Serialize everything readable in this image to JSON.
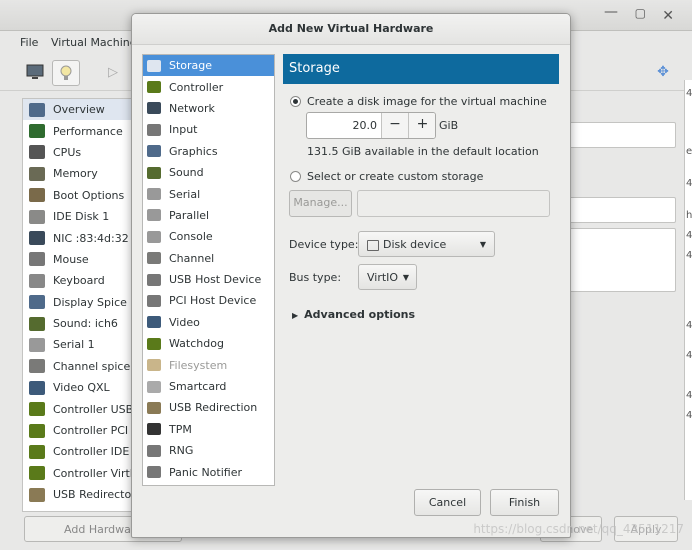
{
  "background_window": {
    "menu": [
      "File",
      "Virtual Machine"
    ],
    "hardware_list": [
      {
        "label": "Overview",
        "icon": "monitor-icon",
        "selected": true
      },
      {
        "label": "Performance",
        "icon": "performance-graph-icon"
      },
      {
        "label": "CPUs",
        "icon": "cpu-icon"
      },
      {
        "label": "Memory",
        "icon": "memory-icon"
      },
      {
        "label": "Boot Options",
        "icon": "boot-options-icon"
      },
      {
        "label": "IDE Disk 1",
        "icon": "disk-icon"
      },
      {
        "label": "NIC :83:4d:32",
        "icon": "nic-icon"
      },
      {
        "label": "Mouse",
        "icon": "mouse-icon"
      },
      {
        "label": "Keyboard",
        "icon": "keyboard-icon"
      },
      {
        "label": "Display Spice",
        "icon": "display-icon"
      },
      {
        "label": "Sound: ich6",
        "icon": "sound-icon"
      },
      {
        "label": "Serial 1",
        "icon": "serial-icon"
      },
      {
        "label": "Channel spice",
        "icon": "channel-icon"
      },
      {
        "label": "Video QXL",
        "icon": "video-icon"
      },
      {
        "label": "Controller USB",
        "icon": "controller-icon"
      },
      {
        "label": "Controller PCI",
        "icon": "controller-icon"
      },
      {
        "label": "Controller IDE",
        "icon": "controller-icon"
      },
      {
        "label": "Controller VirtIO",
        "icon": "controller-icon"
      },
      {
        "label": "USB Redirector",
        "icon": "usb-redirector-icon"
      }
    ],
    "add_hardware_label": "Add Hardware",
    "remove_label": "Remove",
    "apply_label": "Apply"
  },
  "dialog": {
    "title": "Add New Virtual Hardware",
    "device_list": [
      {
        "label": "Storage",
        "icon": "storage-icon",
        "selected": true
      },
      {
        "label": "Controller",
        "icon": "controller-icon"
      },
      {
        "label": "Network",
        "icon": "network-icon"
      },
      {
        "label": "Input",
        "icon": "input-mouse-icon"
      },
      {
        "label": "Graphics",
        "icon": "graphics-monitor-icon"
      },
      {
        "label": "Sound",
        "icon": "sound-card-icon"
      },
      {
        "label": "Serial",
        "icon": "serial-icon"
      },
      {
        "label": "Parallel",
        "icon": "parallel-icon"
      },
      {
        "label": "Console",
        "icon": "console-icon"
      },
      {
        "label": "Channel",
        "icon": "channel-icon"
      },
      {
        "label": "USB Host Device",
        "icon": "usb-host-icon"
      },
      {
        "label": "PCI Host Device",
        "icon": "pci-host-icon"
      },
      {
        "label": "Video",
        "icon": "video-icon"
      },
      {
        "label": "Watchdog",
        "icon": "watchdog-icon"
      },
      {
        "label": "Filesystem",
        "icon": "filesystem-icon",
        "disabled": true
      },
      {
        "label": "Smartcard",
        "icon": "smartcard-icon"
      },
      {
        "label": "USB Redirection",
        "icon": "usb-redirection-icon"
      },
      {
        "label": "TPM",
        "icon": "tpm-icon"
      },
      {
        "label": "RNG",
        "icon": "rng-icon"
      },
      {
        "label": "Panic Notifier",
        "icon": "panic-notifier-icon"
      }
    ],
    "storage": {
      "header": "Storage",
      "create_disk_label": "Create a disk image for the virtual machine",
      "size_value": "20.0",
      "size_unit": "GiB",
      "available_text": "131.5 GiB available in the default location",
      "custom_storage_label": "Select or create custom storage",
      "manage_label": "Manage...",
      "device_type_label": "Device type:",
      "device_type_value": "Disk device",
      "bus_type_label": "Bus type:",
      "bus_type_value": "VirtIO",
      "advanced_label": "Advanced options"
    },
    "cancel_label": "Cancel",
    "finish_label": "Finish"
  },
  "watermark": "https://blog.csdn.net/qq_43511217",
  "colors": {
    "selection_blue": "#4a90d9",
    "storage_header_bg": "#0e6a9e",
    "desktop_teal": "#3f8f96"
  }
}
